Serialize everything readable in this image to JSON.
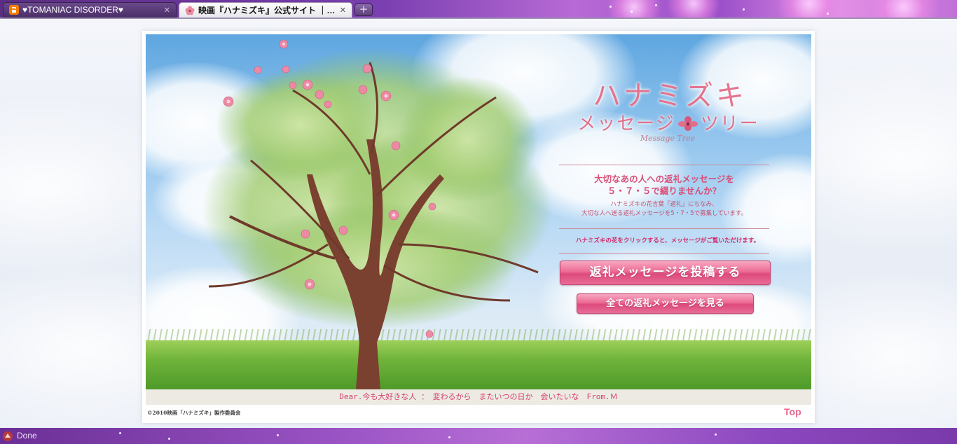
{
  "browser": {
    "tabs": [
      {
        "title": "♥TOMANIAC DISORDER♥",
        "icon": "blogger-icon",
        "active": false,
        "close": "✕"
      },
      {
        "title": "映画『ハナミズキ』公式サイト ｜ ...",
        "icon": "sakura-icon",
        "active": true,
        "close": "✕"
      }
    ],
    "new_tab": "+",
    "status_text": "Done",
    "accent": "#7a3fb0"
  },
  "page": {
    "title_main": "ハナミズキ",
    "title_sub_left": "メッセージ",
    "title_sub_right": "ツリー",
    "title_en": "Message Tree",
    "lead_line1": "大切なあの人への返礼メッセージを",
    "lead_line2": "５・７・５で綴りませんか？",
    "desc_line1": "ハナミズキの花言葉「返礼」にちなみ、",
    "desc_line2": "大切な人へ送る返礼メッセージを5・7・5で募集しています。",
    "instruction": "ハナミズキの花をクリックすると、メッセージがご覧いただけます。",
    "post_button": "返礼メッセージを投稿する",
    "view_all_button": "全ての返礼メッセージを見る",
    "ticker": "Dear.今も大好きな人 ：　変わるから　またいつの日か　会いたいな　From.Ｍ",
    "copyright": "©2010映画「ハナミズキ」製作委員会",
    "top_link": "Top",
    "colors": {
      "pink": "#e3748e",
      "button": "#e86d96",
      "sky": "#8cc1ec"
    }
  }
}
